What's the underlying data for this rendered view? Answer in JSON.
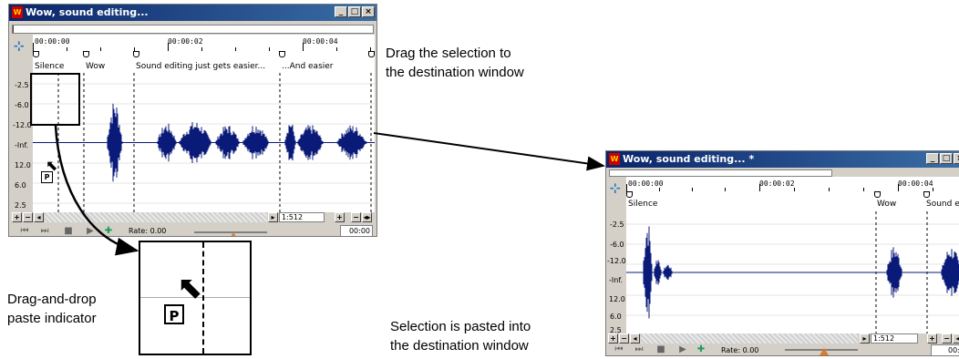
{
  "source_window": {
    "title": "Wow, sound editing...",
    "ruler_times": [
      "00:00:00",
      "00:00:02",
      "00:00:04"
    ],
    "regions": [
      "Silence",
      "Wow",
      "Sound editing just gets easier...",
      "...And easier"
    ],
    "db_labels": [
      "-2.5",
      "-6.0",
      "-12.0",
      "-Inf.",
      "12.0",
      "6.0",
      "2.5"
    ],
    "zoom": "1:512",
    "rate": "Rate: 0.00",
    "time": "00:00"
  },
  "dest_window": {
    "title": "Wow, sound editing... *",
    "ruler_times": [
      "00:00:00",
      "00:00:02",
      "00:00:04"
    ],
    "regions": [
      "Silence",
      "Wow",
      "Sound e"
    ],
    "db_labels": [
      "-2.5",
      "-6.0",
      "-12.0",
      "-Inf.",
      "12.0",
      "6.0",
      "2.5"
    ],
    "zoom": "1:512",
    "rate": "Rate: 0.00",
    "time": "00:0"
  },
  "window_buttons": {
    "minimize": "_",
    "maximize": "□",
    "close": "×"
  },
  "zoom_in_label": "+",
  "zoom_out_label": "−",
  "paste_badge": "P",
  "callouts": {
    "drag_line1": "Drag the selection to",
    "drag_line2": "the destination window",
    "indicator_line1": "Drag-and-drop",
    "indicator_line2": "paste indicator",
    "pasted_line1": "Selection is pasted into",
    "pasted_line2": "the destination window"
  },
  "colors": {
    "waveform": "#0a1a78",
    "titlebar": "#0a246a",
    "accent_knob": "#e07a2a"
  }
}
